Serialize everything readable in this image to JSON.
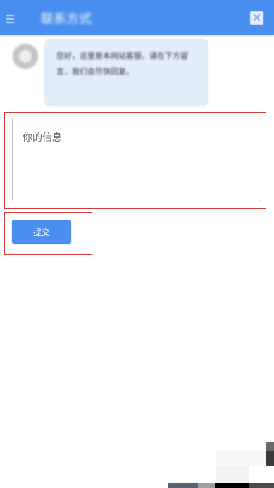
{
  "header": {
    "title": "联系方式",
    "menu_icon": "menu-icon",
    "close_icon": "close-icon",
    "background_color": "#4a8ef0"
  },
  "chat": {
    "avatar_icon": "avatar-icon",
    "bot_message": "您好，这里是本网站客服，请在下方留言，我们会尽快回复。"
  },
  "form": {
    "message_placeholder": "你的信息",
    "message_value": "",
    "submit_label": "提交"
  },
  "colors": {
    "accent": "#4a8ef0",
    "highlight_border": "#d43a3a",
    "bubble_background": "#e2edfa"
  }
}
